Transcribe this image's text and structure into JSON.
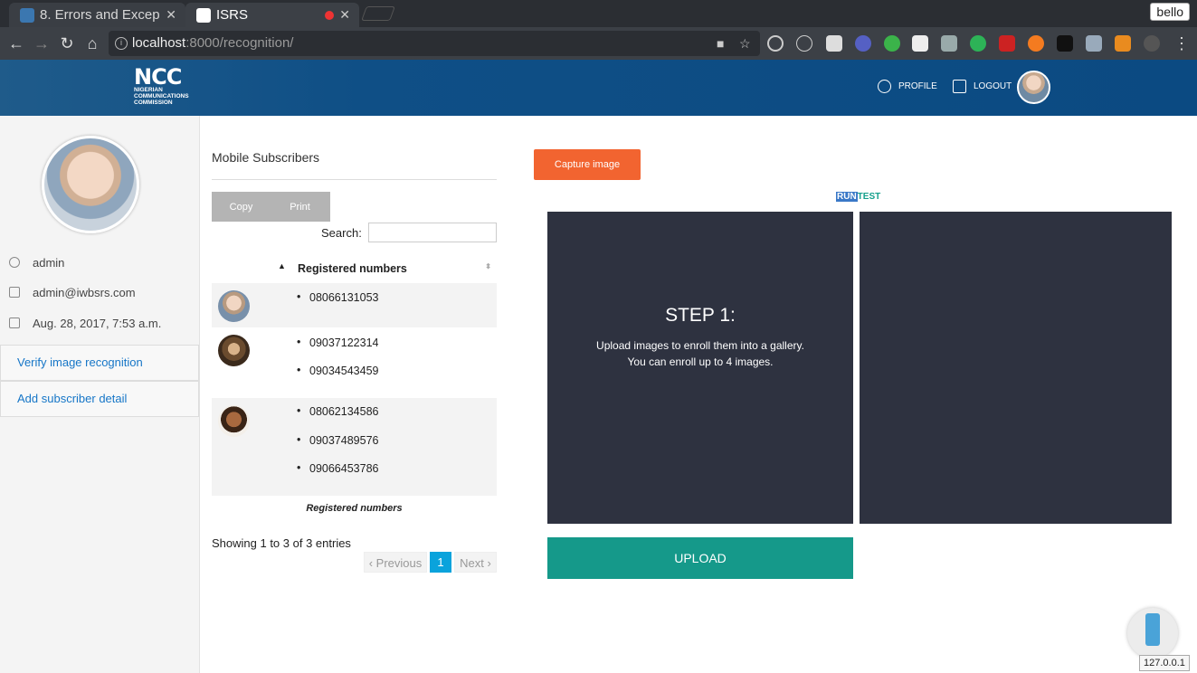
{
  "browser": {
    "tabs": [
      {
        "title": "8. Errors and Excep"
      },
      {
        "title": "ISRS"
      }
    ],
    "user_chip": "bello",
    "url": {
      "host": "localhost",
      "path": ":8000/recognition/"
    },
    "status_host": "127.0.0.1"
  },
  "header": {
    "logo_big": "NCC",
    "logo_line1": "NIGERIAN",
    "logo_line2": "COMMUNICATIONS",
    "logo_line3": "COMMISSION",
    "profile": "PROFILE",
    "logout": "LOGOUT"
  },
  "sidebar": {
    "username": "admin",
    "email": "admin@iwbsrs.com",
    "date": "Aug. 28, 2017, 7:53 a.m.",
    "links": [
      "Verify image recognition",
      "Add subscriber detail"
    ]
  },
  "table": {
    "title": "Mobile Subscribers",
    "buttons": [
      "Copy",
      "Print"
    ],
    "search_label": "Search:",
    "column": "Registered numbers",
    "footer_column": "Registered numbers",
    "rows": [
      {
        "numbers": [
          "08066131053"
        ]
      },
      {
        "numbers": [
          "09037122314",
          "09034543459"
        ]
      },
      {
        "numbers": [
          "08062134586",
          "09037489576",
          "09066453786"
        ]
      }
    ],
    "info": "Showing 1 to 3 of 3 entries",
    "pager": {
      "prev": "‹ Previous",
      "current": "1",
      "next": "Next ›"
    }
  },
  "recognition": {
    "capture_button": "Capture image",
    "run": "RUN",
    "test": "TEST",
    "step_title": "STEP 1:",
    "step_line1": "Upload images to enroll them into a gallery.",
    "step_line2": "You can enroll up to 4 images.",
    "upload_button": "UPLOAD"
  },
  "colors": {
    "header": "#0b4a82",
    "capture": "#f26430",
    "upload": "#15998a",
    "pane": "#2e3240",
    "link": "#1676c7"
  }
}
